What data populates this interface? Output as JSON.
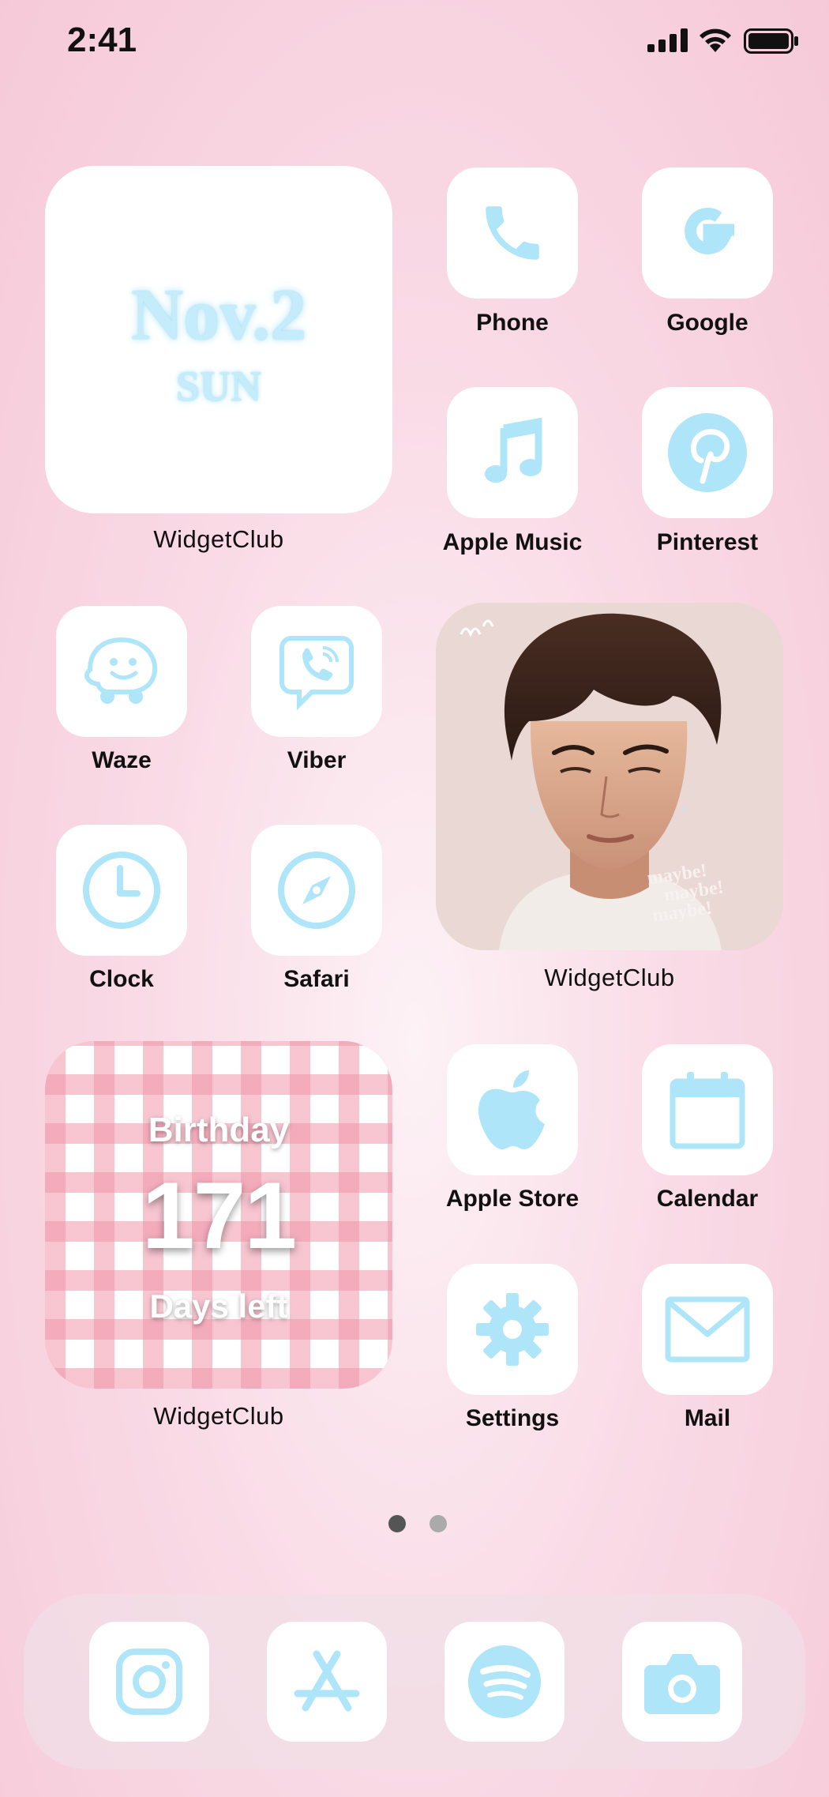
{
  "status_bar": {
    "time": "2:41"
  },
  "accent_color": "#aee5f8",
  "date_widget": {
    "date": "Nov.2",
    "day": "SUN",
    "label": "WidgetClub"
  },
  "photo_widget": {
    "label": "WidgetClub",
    "overlay_text": "maybe! maybe! maybe!"
  },
  "countdown_widget": {
    "title": "Birthday",
    "days": "171",
    "subtitle": "Days left",
    "label": "WidgetClub"
  },
  "apps": {
    "phone": {
      "label": "Phone",
      "icon": "phone-icon"
    },
    "google": {
      "label": "Google",
      "icon": "google-icon"
    },
    "apple_music": {
      "label": "Apple Music",
      "icon": "music-note-icon"
    },
    "pinterest": {
      "label": "Pinterest",
      "icon": "pinterest-icon"
    },
    "waze": {
      "label": "Waze",
      "icon": "waze-icon"
    },
    "viber": {
      "label": "Viber",
      "icon": "viber-icon"
    },
    "clock": {
      "label": "Clock",
      "icon": "clock-icon"
    },
    "safari": {
      "label": "Safari",
      "icon": "compass-icon"
    },
    "apple_store": {
      "label": "Apple Store",
      "icon": "apple-icon"
    },
    "calendar": {
      "label": "Calendar",
      "icon": "calendar-icon"
    },
    "settings": {
      "label": "Settings",
      "icon": "gear-icon"
    },
    "mail": {
      "label": "Mail",
      "icon": "mail-icon"
    }
  },
  "dock": [
    {
      "name": "Instagram",
      "icon": "instagram-icon"
    },
    {
      "name": "App Store",
      "icon": "app-store-icon"
    },
    {
      "name": "Spotify",
      "icon": "spotify-icon"
    },
    {
      "name": "Camera",
      "icon": "camera-icon"
    }
  ],
  "page_indicator": {
    "current": 1,
    "total": 2
  }
}
